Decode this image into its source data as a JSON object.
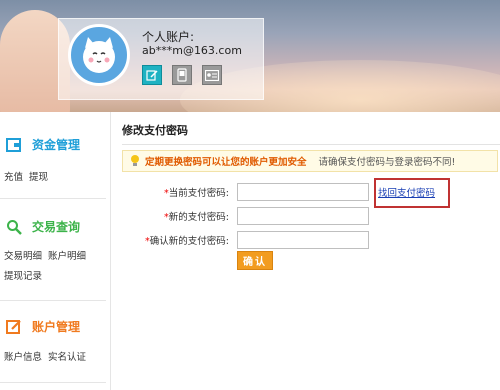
{
  "header": {
    "account_label": "个人账户:",
    "account_email": "ab***m@163.com",
    "icons": [
      "edit-icon",
      "phone-icon",
      "id-card-icon"
    ]
  },
  "sidebar": {
    "sections": [
      {
        "title": "资金管理",
        "icon": "wallet-icon",
        "color": "#1f9fd8",
        "links": [
          "充值",
          "提现"
        ]
      },
      {
        "title": "交易查询",
        "icon": "search-icon",
        "color": "#3cb34a",
        "links": [
          "交易明细",
          "账户明细",
          "提现记录"
        ]
      },
      {
        "title": "账户管理",
        "icon": "edit-icon",
        "color": "#f07a1f",
        "links": [
          "账户信息",
          "实名认证"
        ]
      }
    ]
  },
  "main": {
    "title": "修改支付密码",
    "notice_warning": "定期更换密码可以让您的账户更加安全",
    "notice_info": "请确保支付密码与登录密码不同!",
    "fields": [
      {
        "required_mark": "*",
        "label": "当前支付密码:",
        "value": ""
      },
      {
        "required_mark": "*",
        "label": "新的支付密码:",
        "value": ""
      },
      {
        "required_mark": "*",
        "label": "确认新的支付密码:",
        "value": ""
      }
    ],
    "recover_link": "找回支付密码",
    "confirm_button": "确认"
  },
  "colors": {
    "accent_orange": "#f29c1f",
    "link_blue": "#1a3fb4",
    "warning_orange": "#e05a00",
    "highlight_red": "#c03232"
  }
}
